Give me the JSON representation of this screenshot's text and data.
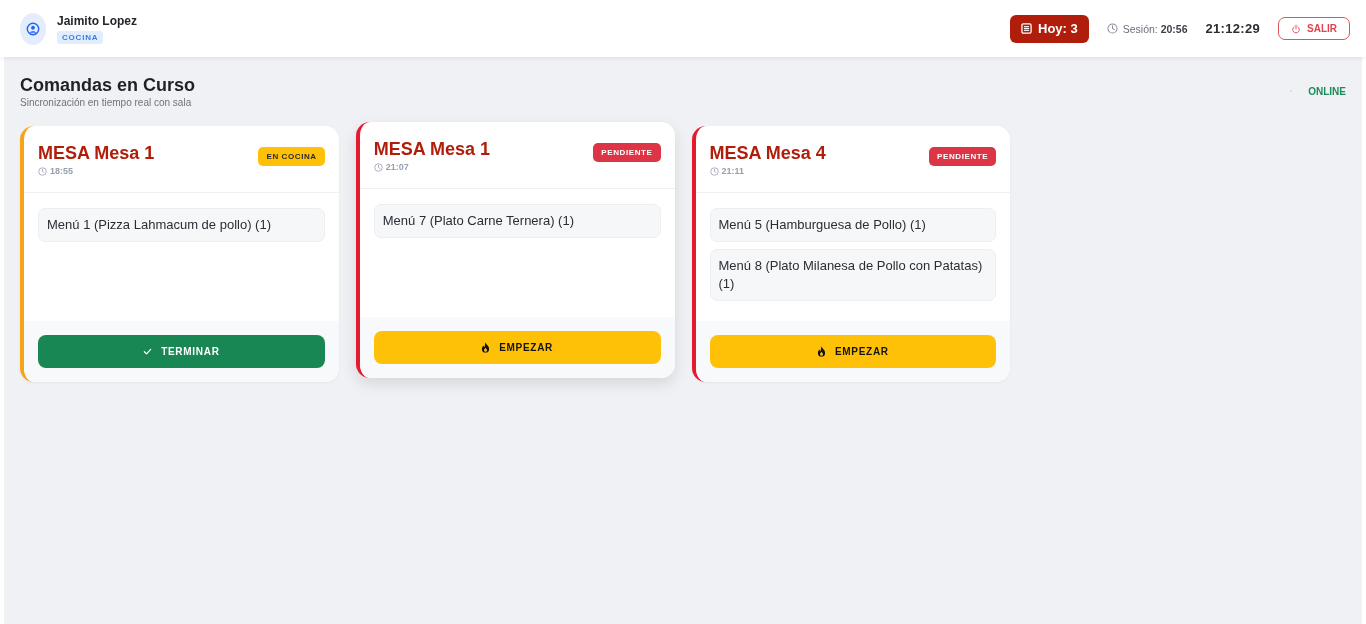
{
  "header": {
    "user": {
      "name": "Jaimito Lopez",
      "role": "COCINA"
    },
    "today_button": "Hoy: 3",
    "session": "Sesión: **20:56**",
    "clock": "21:12:29",
    "logout_button": "SALIR"
  },
  "page": {
    "title": "Comandas en Curso",
    "subtitle": "Sincronización en tiempo real con sala",
    "connection": "ONLINE"
  },
  "orders": [
    {
      "table": "MESA Mesa 1",
      "time": "18:55",
      "status": {
        "kind": "cooking",
        "label": "EN COCINA"
      },
      "items": [
        "Menú 1 (Pizza Lahmacum de pollo) (1)"
      ],
      "action": {
        "kind": "finish",
        "label": "TERMINAR"
      },
      "hovered": false
    },
    {
      "table": "MESA Mesa 1",
      "time": "21:07",
      "status": {
        "kind": "pending",
        "label": "PENDIENTE"
      },
      "items": [
        "Menú 7 (Plato Carne Ternera) (1)"
      ],
      "action": {
        "kind": "start",
        "label": "EMPEZAR"
      },
      "hovered": true
    },
    {
      "table": "MESA Mesa 4",
      "time": "21:11",
      "status": {
        "kind": "pending",
        "label": "PENDIENTE"
      },
      "items": [
        "Menú 5 (Hamburguesa de Pollo) (1)",
        "Menú 8 (Plato Milanesa de Pollo con Patatas) (1)"
      ],
      "action": {
        "kind": "start",
        "label": "EMPEZAR"
      },
      "hovered": false
    }
  ]
}
